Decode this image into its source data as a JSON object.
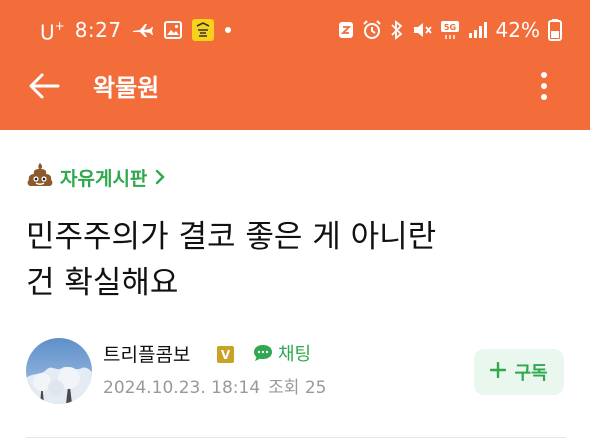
{
  "status_bar": {
    "carrier": "U",
    "carrier_sup": "+",
    "time": "8:27",
    "battery": "42%"
  },
  "toolbar": {
    "title": "왁물원"
  },
  "board": {
    "name": "자유게시판"
  },
  "post": {
    "title_line1": "민주주의가 결코 좋은 게 아니란",
    "title_line2": "건 확실해요"
  },
  "author": {
    "name": "트리플콤보",
    "badge": "V",
    "chat_label": "채팅",
    "date": "2024.10.23. 18:14",
    "views": "조회 25"
  },
  "subscribe": {
    "label": "구독"
  },
  "colors": {
    "appbar": "#f26d3a",
    "accent_green": "#2fa84f",
    "subscribe_bg": "#e9f7ee",
    "badge_gold": "#c9a227"
  }
}
